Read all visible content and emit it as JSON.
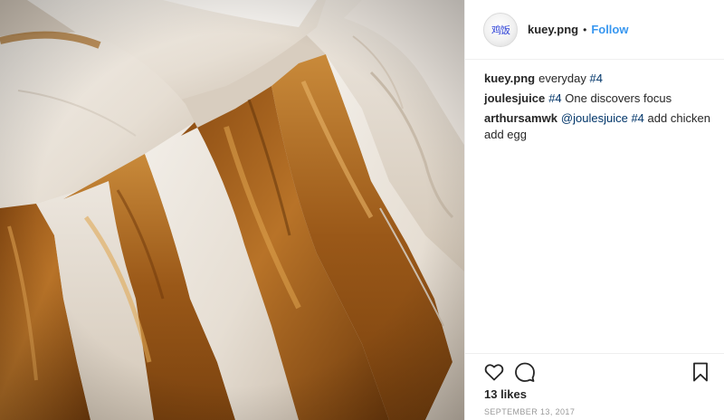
{
  "photo": {
    "alt_subject": "sliced roasted chicken"
  },
  "header": {
    "avatar_text": "鸡饭",
    "username": "kuey.png",
    "separator": "•",
    "follow_label": "Follow"
  },
  "comments": [
    {
      "user": "kuey.png",
      "text": "everyday",
      "tag": "#4",
      "mention": "",
      "rest": ""
    },
    {
      "user": "joulesjuice",
      "text": "",
      "tag": "#4",
      "mention": "",
      "rest": "One discovers focus"
    },
    {
      "user": "arthursamwk",
      "text": "",
      "tag": "#4",
      "mention": "@joulesjuice",
      "rest": "add chicken add egg"
    }
  ],
  "actions": {
    "like_icon": "heart-icon",
    "comment_icon": "comment-icon",
    "save_icon": "bookmark-icon",
    "likes_text": "13 likes",
    "date_text": "SEPTEMBER 13, 2017"
  },
  "colors": {
    "accent": "#3897f0",
    "hashtag": "#003569",
    "text": "#262626",
    "muted": "#999999"
  }
}
